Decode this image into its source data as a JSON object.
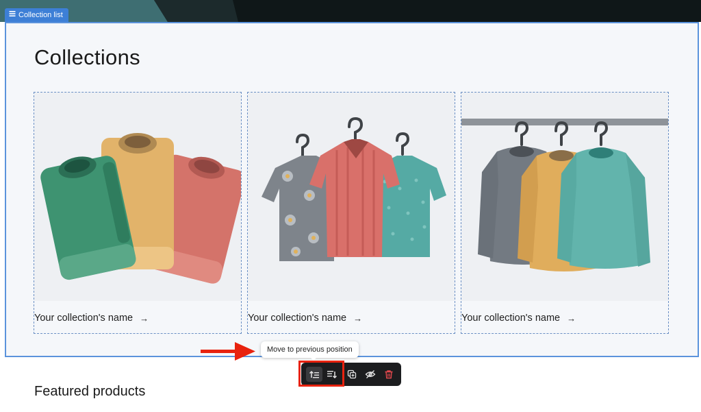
{
  "section": {
    "tag_label": "Collection list",
    "title": "Collections"
  },
  "collections": [
    {
      "name": "Your collection's name",
      "arrow": "→",
      "image_icon": "folded-shirts-illustration"
    },
    {
      "name": "Your collection's name",
      "arrow": "→",
      "image_icon": "hanging-shirts-illustration"
    },
    {
      "name": "Your collection's name",
      "arrow": "→",
      "image_icon": "rack-sweaters-illustration"
    }
  ],
  "tooltip": {
    "text": "Move to previous position"
  },
  "toolbar": {
    "buttons": [
      "move-previous-icon",
      "move-next-icon",
      "duplicate-icon",
      "hide-icon",
      "delete-icon"
    ],
    "delete_color": "#e5484d"
  },
  "annotation": {
    "color": "#e8220e"
  },
  "next_section": {
    "title": "Featured products"
  },
  "colors": {
    "accent": "#3d7fd6",
    "frame": "#5b93dc",
    "toolbar_bg": "#1c1d1f"
  }
}
